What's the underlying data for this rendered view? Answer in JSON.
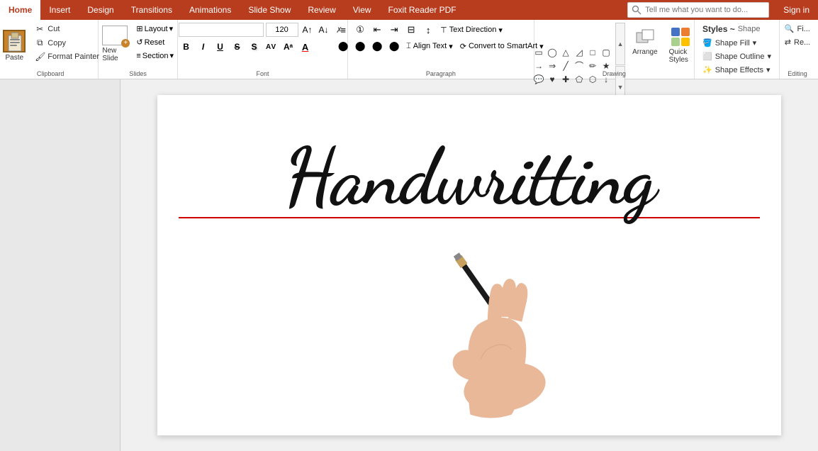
{
  "tabs": {
    "items": [
      {
        "label": "Home",
        "active": true
      },
      {
        "label": "Insert",
        "active": false
      },
      {
        "label": "Design",
        "active": false
      },
      {
        "label": "Transitions",
        "active": false
      },
      {
        "label": "Animations",
        "active": false
      },
      {
        "label": "Slide Show",
        "active": false
      },
      {
        "label": "Review",
        "active": false
      },
      {
        "label": "View",
        "active": false
      },
      {
        "label": "Foxit Reader PDF",
        "active": false
      }
    ],
    "search_placeholder": "Tell me what you want to do...",
    "sign_in": "Sign in"
  },
  "clipboard": {
    "label": "Clipboard",
    "paste": "Paste",
    "cut": "Cut",
    "copy": "Copy",
    "format_painter": "Format Painter"
  },
  "slides": {
    "label": "Slides",
    "new_slide": "New Slide",
    "layout": "Layout",
    "reset": "Reset",
    "section": "Section"
  },
  "font": {
    "label": "Font",
    "font_name": "",
    "font_size": "120",
    "bold": "B",
    "italic": "I",
    "underline": "U",
    "strikethrough": "S",
    "shadow": "S",
    "char_spacing": "AV",
    "font_color": "A",
    "clear_format": "✗"
  },
  "paragraph": {
    "label": "Paragraph"
  },
  "drawing": {
    "label": "Drawing",
    "arrange": "Arrange",
    "quick_styles": "Quick Styles"
  },
  "right_panel": {
    "shape_fill": "Shape Fill",
    "shape_outline": "Shape Outline",
    "shape_effects": "Shape Effects",
    "styles_label": "Styles ~",
    "shape_label": "Shape"
  },
  "editing": {
    "label": "Editing",
    "find": "Fi...",
    "replace": "Re..."
  },
  "slide": {
    "title": "Handwritting"
  }
}
